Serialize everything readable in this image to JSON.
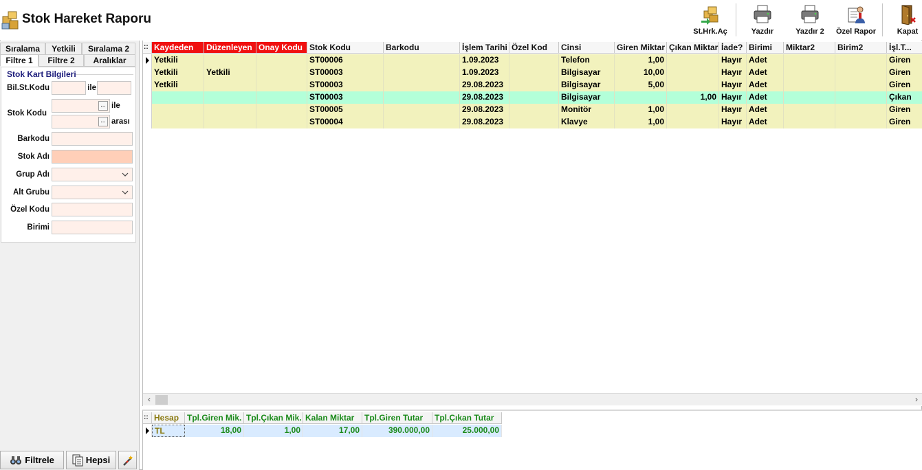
{
  "header": {
    "title": "Stok Hareket Raporu",
    "buttons": [
      {
        "id": "sthrkac",
        "label": "St.Hrk.Aç",
        "icon": "open-movement-icon"
      },
      {
        "id": "yazdir",
        "label": "Yazdır",
        "icon": "printer-icon"
      },
      {
        "id": "yazdir2",
        "label": "Yazdır 2",
        "icon": "printer-icon"
      },
      {
        "id": "ozelrapor",
        "label": "Özel Rapor",
        "icon": "custom-report-icon"
      },
      {
        "id": "kapat",
        "label": "Kapat",
        "icon": "exit-door-icon"
      }
    ]
  },
  "left": {
    "tabs_row1": [
      "Sıralama",
      "Yetkili",
      "Sıralama 2"
    ],
    "tabs_row2": [
      "Filtre 1",
      "Filtre 2",
      "Aralıklar"
    ],
    "active_tab": "Filtre 1",
    "group_title": "Stok Kart Bilgileri",
    "labels": {
      "bil_st_kodu": "Bil.St.Kodu",
      "ile": "ile",
      "stok_kodu": "Stok Kodu",
      "ile2": "ile",
      "arasi": "arası",
      "barkodu": "Barkodu",
      "stok_adi": "Stok Adı",
      "grup_adi": "Grup Adı",
      "alt_grubu": "Alt Grubu",
      "ozel_kodu": "Özel Kodu",
      "birimi": "Birimi"
    },
    "ellipsis": "...",
    "buttons": {
      "filtrele": "Filtrele",
      "hepsi": "Hepsi"
    }
  },
  "grid": {
    "columns": [
      "Kaydeden",
      "Düzenleyen",
      "Onay Kodu",
      "Stok Kodu",
      "Barkodu",
      "İşlem Tarihi",
      "Özel Kod",
      "Cinsi",
      "Giren Miktar",
      "Çıkan Miktar",
      "İade?",
      "Birimi",
      "Miktar2",
      "Birim2",
      "İşl.T..."
    ],
    "rows": [
      {
        "kaydeden": "Yetkili",
        "duzenleyen": "",
        "onay": "",
        "stok_kodu": "ST00006",
        "barkodu": "",
        "tarih": "1.09.2023",
        "ozel": "",
        "cinsi": "Telefon",
        "giren": "1,00",
        "cikan": "",
        "iade": "Hayır",
        "birimi": "Adet",
        "miktar2": "",
        "birim2": "",
        "islt": "Giren",
        "current": true,
        "color": "#f2f2bd"
      },
      {
        "kaydeden": "Yetkili",
        "duzenleyen": "Yetkili",
        "onay": "",
        "stok_kodu": "ST00003",
        "barkodu": "",
        "tarih": "1.09.2023",
        "ozel": "",
        "cinsi": "Bilgisayar",
        "giren": "10,00",
        "cikan": "",
        "iade": "Hayır",
        "birimi": "Adet",
        "miktar2": "",
        "birim2": "",
        "islt": "Giren",
        "current": false,
        "color": "#f2f2bd"
      },
      {
        "kaydeden": "Yetkili",
        "duzenleyen": "",
        "onay": "",
        "stok_kodu": "ST00003",
        "barkodu": "",
        "tarih": "29.08.2023",
        "ozel": "",
        "cinsi": "Bilgisayar",
        "giren": "5,00",
        "cikan": "",
        "iade": "Hayır",
        "birimi": "Adet",
        "miktar2": "",
        "birim2": "",
        "islt": "Giren",
        "current": false,
        "color": "#f2f2bd"
      },
      {
        "kaydeden": "",
        "duzenleyen": "",
        "onay": "",
        "stok_kodu": "ST00003",
        "barkodu": "",
        "tarih": "29.08.2023",
        "ozel": "",
        "cinsi": "Bilgisayar",
        "giren": "",
        "cikan": "1,00",
        "iade": "Hayır",
        "birimi": "Adet",
        "miktar2": "",
        "birim2": "",
        "islt": "Çıkan",
        "current": false,
        "color": "#b3ffd9"
      },
      {
        "kaydeden": "",
        "duzenleyen": "",
        "onay": "",
        "stok_kodu": "ST00005",
        "barkodu": "",
        "tarih": "29.08.2023",
        "ozel": "",
        "cinsi": "Monitör",
        "giren": "1,00",
        "cikan": "",
        "iade": "Hayır",
        "birimi": "Adet",
        "miktar2": "",
        "birim2": "",
        "islt": "Giren",
        "current": false,
        "color": "#f2f2bd"
      },
      {
        "kaydeden": "",
        "duzenleyen": "",
        "onay": "",
        "stok_kodu": "ST00004",
        "barkodu": "",
        "tarih": "29.08.2023",
        "ozel": "",
        "cinsi": "Klavye",
        "giren": "1,00",
        "cikan": "",
        "iade": "Hayır",
        "birimi": "Adet",
        "miktar2": "",
        "birim2": "",
        "islt": "Giren",
        "current": false,
        "color": "#f2f2bd"
      }
    ]
  },
  "summary": {
    "columns": [
      "Hesap",
      "Tpl.Giren Mik.",
      "Tpl.Çıkan Mik.",
      "Kalan Miktar",
      "Tpl.Giren Tutar",
      "Tpl.Çıkan Tutar"
    ],
    "row": {
      "hesap": "TL",
      "tpl_giren_mik": "18,00",
      "tpl_cikan_mik": "1,00",
      "kalan": "17,00",
      "tpl_giren_tutar": "390.000,00",
      "tpl_cikan_tutar": "25.000,00"
    }
  },
  "colors": {
    "header_red": "#f01010",
    "row_yellow": "#f2f2bd",
    "row_green": "#b3ffd9",
    "summary_row": "#d9ebff",
    "summary_text": "#1a8a1a",
    "field_fill": "#fff0ea",
    "field_strong": "#ffcfb8"
  }
}
